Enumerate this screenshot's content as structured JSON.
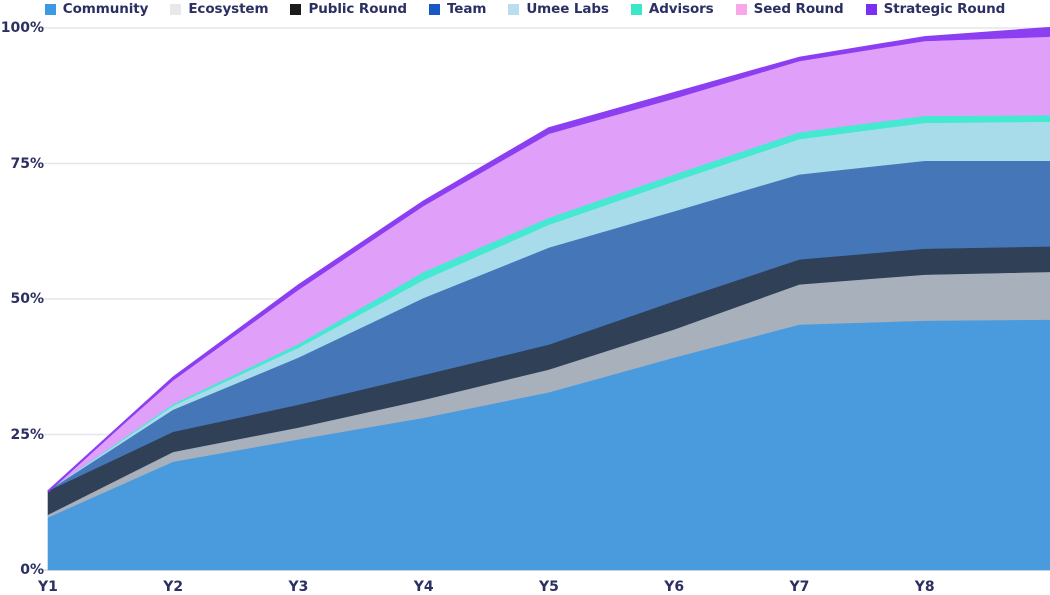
{
  "legend": {
    "items": [
      {
        "label": "Community",
        "color": "#3b9ae1"
      },
      {
        "label": "Ecosystem",
        "color": "#e8e8ea"
      },
      {
        "label": "Public Round",
        "color": "#1b1b1b"
      },
      {
        "label": "Team",
        "color": "#1857c4"
      },
      {
        "label": "Umee Labs",
        "color": "#b9dfee"
      },
      {
        "label": "Advisors",
        "color": "#3ae8c6"
      },
      {
        "label": "Seed Round",
        "color": "#f9a8e7"
      },
      {
        "label": "Strategic Round",
        "color": "#7b2ff2"
      }
    ]
  },
  "axes": {
    "y_ticks": [
      "0%",
      "25%",
      "50%",
      "75%",
      "100%"
    ],
    "x_ticks": [
      "Y1",
      "Y2",
      "Y3",
      "Y4",
      "Y5",
      "Y6",
      "Y7",
      "Y8"
    ]
  },
  "colors": {
    "grid": "#e6e6ea",
    "axis_text": "#2b2f62",
    "background": "#ffffff",
    "community_area": "#4a9ade",
    "ecosystem_area": "#a7b0bb",
    "public_round_area": "#2f4057",
    "team_area": "#4576b8",
    "umee_labs_area": "#a9dceb",
    "advisors_area": "#45e8d0",
    "seed_round_area": "#e0a0fa",
    "strategic_round_area": "#8b3ff0"
  },
  "chart_data": {
    "type": "area",
    "title": "",
    "subtitle": "",
    "xlabel": "",
    "ylabel": "",
    "stacked": true,
    "percent_stacked": true,
    "grid": true,
    "legend_position": "top",
    "ylim": [
      0,
      100
    ],
    "ytick_values": [
      0,
      25,
      50,
      75,
      100
    ],
    "x": [
      "Y1",
      "Y2",
      "Y3",
      "Y4",
      "Y5",
      "Y6",
      "Y7",
      "Y8",
      "Y8+"
    ],
    "x_note": "Final point extends past the Y8 tick to the right plot edge where the stack totals 100%.",
    "series": [
      {
        "name": "Community",
        "color": "#4a9ade",
        "values": [
          9.6,
          19.9,
          24.0,
          28.0,
          32.7,
          39.1,
          45.2,
          45.9,
          46.1
        ]
      },
      {
        "name": "Ecosystem",
        "color": "#a7b0bb",
        "values": [
          0.5,
          1.8,
          2.2,
          3.3,
          4.2,
          5.2,
          7.4,
          8.5,
          8.8
        ]
      },
      {
        "name": "Public Round",
        "color": "#2f4057",
        "values": [
          4.4,
          3.7,
          4.2,
          4.6,
          4.6,
          5.2,
          4.6,
          4.8,
          4.7
        ]
      },
      {
        "name": "Team",
        "color": "#4576b8",
        "values": [
          0.0,
          4.1,
          8.7,
          14.2,
          17.9,
          16.6,
          15.7,
          16.2,
          15.8
        ]
      },
      {
        "name": "Umee Labs",
        "color": "#a9dceb",
        "values": [
          0.0,
          0.7,
          1.8,
          3.3,
          4.2,
          5.5,
          6.5,
          7.0,
          7.2
        ]
      },
      {
        "name": "Advisors",
        "color": "#45e8d0",
        "values": [
          0.0,
          0.3,
          0.7,
          1.5,
          1.3,
          1.3,
          1.3,
          1.3,
          1.2
        ]
      },
      {
        "name": "Seed Round",
        "color": "#e0a0fa",
        "values": [
          0.0,
          4.4,
          10.0,
          12.2,
          15.5,
          14.0,
          13.1,
          13.8,
          14.5
        ]
      },
      {
        "name": "Strategic Round",
        "color": "#8b3ff0",
        "values": [
          0.0,
          0.6,
          0.9,
          0.9,
          1.1,
          1.1,
          0.7,
          0.8,
          1.7
        ]
      }
    ],
    "cumulative_tops": {
      "Community": [
        9.6,
        19.9,
        24.0,
        28.0,
        32.7,
        39.1,
        45.2,
        45.9,
        46.1
      ],
      "Ecosystem": [
        10.1,
        21.7,
        26.2,
        31.3,
        36.9,
        44.3,
        52.6,
        54.4,
        54.9
      ],
      "Public Round": [
        14.5,
        25.4,
        30.4,
        35.9,
        41.5,
        49.5,
        57.2,
        59.2,
        59.6
      ],
      "Team": [
        14.5,
        29.5,
        39.1,
        50.1,
        59.4,
        66.1,
        72.9,
        75.4,
        75.4
      ],
      "Umee Labs": [
        14.5,
        30.2,
        40.9,
        53.4,
        63.6,
        71.6,
        79.4,
        82.4,
        82.6
      ],
      "Advisors": [
        14.5,
        30.5,
        41.6,
        54.9,
        64.9,
        72.9,
        80.7,
        83.7,
        83.8
      ],
      "Seed Round": [
        14.5,
        34.9,
        51.6,
        67.1,
        80.4,
        86.9,
        93.8,
        97.5,
        98.3
      ],
      "Strategic Round": [
        14.5,
        35.5,
        52.5,
        68.0,
        81.5,
        88.0,
        94.5,
        98.3,
        100.0
      ]
    }
  }
}
